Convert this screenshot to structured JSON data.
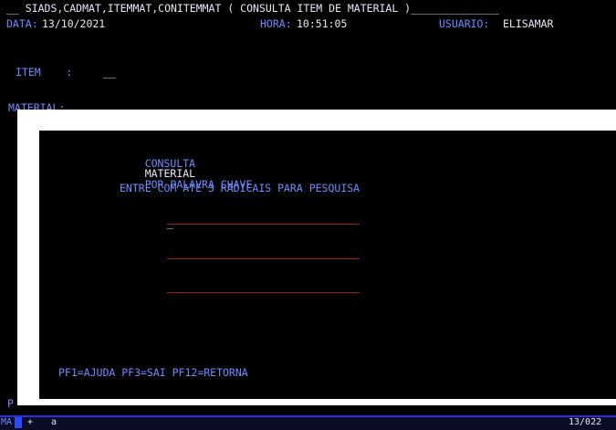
{
  "header": {
    "title_line": "__ SIADS,CADMAT,ITEMMAT,CONITEMMAT ( CONSULTA ITEM DE MATERIAL )______________",
    "date_label": "DATA:",
    "date_value": "13/10/2021",
    "time_label": "HORA:",
    "time_value": "10:51:05",
    "user_label": "USUARIO:",
    "user_value": "ELISAMAR"
  },
  "form": {
    "item_label": "ITEM    :",
    "item_value": "__",
    "material_label": "MATERIAL:"
  },
  "popup": {
    "title_word1": "CONSULTA",
    "title_word2": "MATERIAL",
    "title_rest": "POR PALAVRA CHAVE",
    "instruction": "ENTRE COM ATE 3 RADICAIS PARA PESQUISA",
    "cursor": "_",
    "function_keys": "PF1=AJUDA PF3=SAI PF12=RETORNA"
  },
  "bottom": {
    "p_line": "P"
  },
  "status": {
    "left_indicator": "MA",
    "plus": "+",
    "mode": "a",
    "position": "13/022"
  },
  "colors": {
    "background": "#000000",
    "field_blue": "#6f8cff",
    "white_text": "#e8e8f0",
    "red_line": "#a02020",
    "status_blue": "#2b2be0"
  }
}
